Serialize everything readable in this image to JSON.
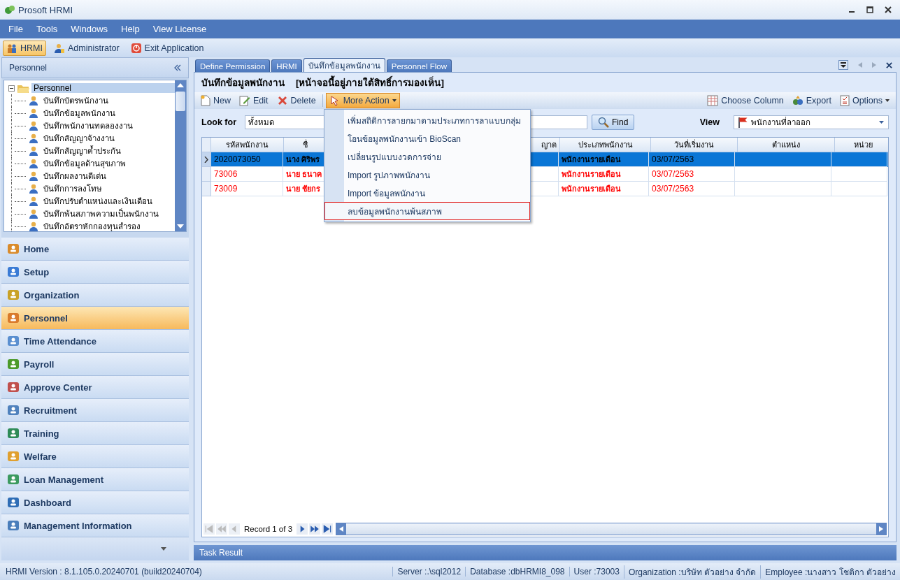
{
  "window": {
    "title": "Prosoft HRMI"
  },
  "menu_bar": [
    "File",
    "Tools",
    "Windows",
    "Help",
    "View License"
  ],
  "toolbar": [
    {
      "label": "HRMI",
      "selected": true
    },
    {
      "label": "Administrator",
      "selected": false
    },
    {
      "label": "Exit Application",
      "selected": false
    }
  ],
  "sidebar": {
    "title": "Personnel",
    "tree": {
      "label": "Personnel",
      "expanded": true,
      "selected": true,
      "children": [
        {
          "label": "บันทึกบัตรพนักงาน"
        },
        {
          "label": "บันทึกข้อมูลพนักงาน"
        },
        {
          "label": "บันทึกพนักงานทดลองงาน"
        },
        {
          "label": "บันทึกสัญญาจ้างงาน"
        },
        {
          "label": "บันทึกสัญญาค้ำประกัน"
        },
        {
          "label": "บันทึกข้อมูลด้านสุขภาพ"
        },
        {
          "label": "บันทึกผลงานดีเด่น"
        },
        {
          "label": "บันทึกการลงโทษ"
        },
        {
          "label": "บันทึกปรับตำแหน่งและเงินเดือน"
        },
        {
          "label": "บันทึกพ้นสภาพความเป็นพนักงาน"
        },
        {
          "label": "บันทึกอัตราหักกองทุนสำรอง"
        }
      ]
    },
    "nav": [
      {
        "label": "Home",
        "selected": false
      },
      {
        "label": "Setup",
        "selected": false
      },
      {
        "label": "Organization",
        "selected": false
      },
      {
        "label": "Personnel",
        "selected": true
      },
      {
        "label": "Time Attendance",
        "selected": false
      },
      {
        "label": "Payroll",
        "selected": false
      },
      {
        "label": "Approve Center",
        "selected": false
      },
      {
        "label": "Recruitment",
        "selected": false
      },
      {
        "label": "Training",
        "selected": false
      },
      {
        "label": "Welfare",
        "selected": false
      },
      {
        "label": "Loan Management",
        "selected": false
      },
      {
        "label": "Dashboard",
        "selected": false
      },
      {
        "label": "Management Information",
        "selected": false
      }
    ]
  },
  "tabs": [
    {
      "label": "Define Permission",
      "selected": false
    },
    {
      "label": "HRMI",
      "selected": false
    },
    {
      "label": "บันทึกข้อมูลพนักงาน",
      "selected": true
    },
    {
      "label": "Personnel Flow",
      "selected": false
    }
  ],
  "page_title": "บันทึกข้อมูลพนักงาน",
  "page_note": "[หน้าจอนี้อยู่ภายใต้สิทธิ์การมองเห็น]",
  "actions": [
    "New",
    "Edit",
    "Delete"
  ],
  "more_action": {
    "label": "More Action",
    "expanded": true,
    "items": [
      {
        "label": "เพิ่มสถิติการลายกมาตามประเภทการลาแบบกลุ่ม",
        "selected": false
      },
      {
        "label": "โอนข้อมูลพนักงานเข้า BioScan",
        "selected": false
      },
      {
        "label": "เปลี่ยนรูปแบบงวดการจ่าย",
        "selected": false
      },
      {
        "label": "Import รูปภาพพนักงาน",
        "selected": false
      },
      {
        "label": "Import ข้อมูลพนักงาน",
        "selected": false
      },
      {
        "label": "ลบข้อมูลพนักงานพ้นสภาพ",
        "selected": true
      }
    ]
  },
  "right_actions": [
    "Choose Column",
    "Export",
    "Options"
  ],
  "search": {
    "label": "Look for",
    "value": "ทั้งหมด",
    "button": "Find"
  },
  "view": {
    "label": "View",
    "value": "พนักงานที่ลาออก"
  },
  "table": {
    "columns": [
      "รหัสพนักงาน",
      "ชื่",
      "ญาต",
      "ประเภทพนักงาน",
      "วันที่เริ่มงาน",
      "ตำแหน่ง",
      "หน่วย"
    ],
    "rows": [
      {
        "selected": true,
        "cells": [
          "2020073050",
          "นาง ศิริพร",
          null,
          "พนักงานรายเดือน",
          "03/07/2563",
          null,
          null
        ]
      },
      {
        "selected": false,
        "color": "#ff0000",
        "cells": [
          "73006",
          "นาย ธนาค",
          null,
          "พนักงานรายเดือน",
          "03/07/2563",
          null,
          null
        ]
      },
      {
        "selected": false,
        "color": "#ff0000",
        "cells": [
          "73009",
          "นาย ชัยกร",
          null,
          "พนักงานรายเดือน",
          "03/07/2563",
          null,
          null
        ]
      }
    ]
  },
  "pager": "Record 1 of 3",
  "task_result": "Task Result",
  "status_bar": {
    "version": "HRMI Version : 8.1.105.0.20240701  (build20240704)",
    "items": [
      "Server :.\\sql2012",
      "Database :dbHRMI8_098",
      "User :73003",
      "Organization :บริษัท ตัวอย่าง จำกัด",
      "Employee :นางสาว โชติกา ตัวอย่าง"
    ]
  }
}
